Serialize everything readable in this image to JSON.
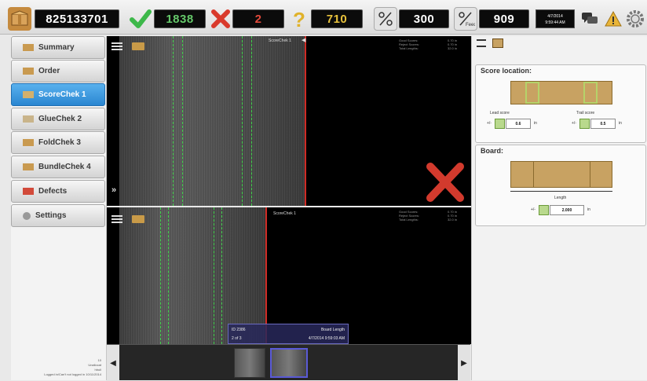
{
  "topbar": {
    "order_number": "825133701",
    "good_count": "1838",
    "reject_count": "2",
    "unknown_count": "710",
    "percent_a": "300",
    "percent_b": "909",
    "datetime_date": "4/7/2014",
    "datetime_time": "9:59:44 AM",
    "icons": [
      "box-icon",
      "checkmark-icon",
      "x-icon",
      "question-icon",
      "percent-icon",
      "percent-head-icon",
      "chat-icon",
      "warning-icon",
      "gear-icon"
    ]
  },
  "sidebar": {
    "items": [
      {
        "label": "Summary",
        "icon": "summary-icon"
      },
      {
        "label": "Order",
        "icon": "order-icon"
      },
      {
        "label": "ScoreChek 1",
        "icon": "scorechek-icon"
      },
      {
        "label": "GlueChek 2",
        "icon": "gluechek-icon"
      },
      {
        "label": "FoldChek 3",
        "icon": "foldchek-icon"
      },
      {
        "label": "BundleChek 4",
        "icon": "bundlechek-icon"
      },
      {
        "label": "Defects",
        "icon": "defects-icon"
      },
      {
        "label": "Settings",
        "icon": "settings-icon"
      }
    ],
    "active_index": 2,
    "footer": [
      "10",
      "Unallocat",
      "hbuli",
      "Logged in/Can't not logged in",
      "10/11/2014"
    ]
  },
  "camera_top": {
    "title": "ScoreChek 1",
    "stats_labels": [
      "Good Scores:",
      "Reject Scores:",
      "Total Lengths:"
    ],
    "stats_values": [
      "0.70 in",
      "0.70 in",
      "32.0 in"
    ]
  },
  "camera_bottom": {
    "title": "ScoreChek 1",
    "stats_labels": [
      "Good Scores:",
      "Reject Scores:",
      "Total Lengths:"
    ],
    "stats_values": [
      "0.70 in",
      "0.70 in",
      "32.0 in"
    ],
    "overlay": {
      "id_label": "ID 2386",
      "index_label": "2 of 3",
      "board_length_label": "Board Length",
      "timestamp": "4/7/2014 9:59:03 AM"
    }
  },
  "right_panel": {
    "score_location": {
      "title": "Score location:",
      "lead_label": "Lead score",
      "lead_prefix": "+/-",
      "lead_value": "0.6",
      "lead_unit": "in",
      "trail_label": "Trail score",
      "trail_prefix": "+/-",
      "trail_value": "0.5",
      "trail_unit": "in"
    },
    "board": {
      "title": "Board:",
      "length_label": "Length",
      "length_prefix": "+/-",
      "length_value": "2.000",
      "length_unit": "in"
    }
  },
  "colors": {
    "accent_blue": "#2a86d1",
    "good_green": "#65c96a",
    "reject_red": "#e24a3b",
    "unknown_yellow": "#e8c23c",
    "board_tan": "#c8a262"
  }
}
